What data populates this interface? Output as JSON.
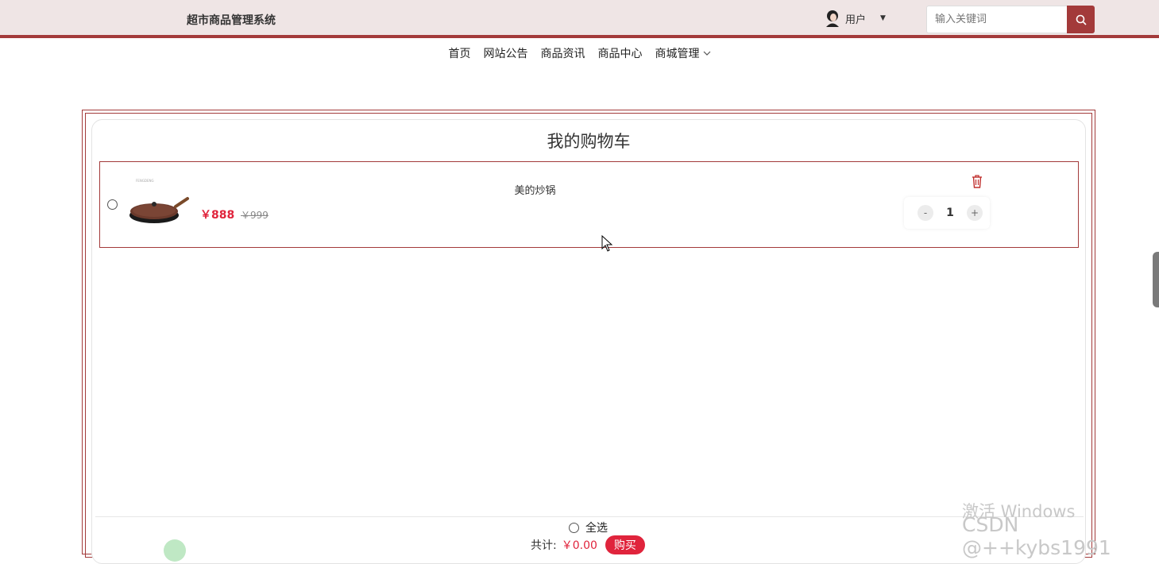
{
  "header": {
    "brand": "超市商品管理系统",
    "user_label": "用户",
    "search_placeholder": "输入关键词",
    "colors": {
      "accent": "#a33a3a",
      "header_bg": "#efe5e5"
    }
  },
  "nav": {
    "items": [
      {
        "label": "首页"
      },
      {
        "label": "网站公告"
      },
      {
        "label": "商品资讯"
      },
      {
        "label": "商品中心"
      },
      {
        "label": "商城管理"
      }
    ]
  },
  "cart": {
    "title": "我的购物车",
    "items": [
      {
        "name": "美的炒锅",
        "price": "￥888",
        "old_price": "￥999",
        "quantity": "1",
        "decrement_label": "-",
        "increment_label": "+",
        "icon_delete": "trash-icon"
      }
    ],
    "footer": {
      "select_all_label": "全选",
      "total_label": "共计:",
      "total_value": "￥0.00",
      "buy_label": "购买"
    },
    "colors": {
      "price": "#e0243c"
    }
  },
  "watermark": {
    "line1": "激活 Windows",
    "line2": "CSDN @++kybs1991"
  }
}
